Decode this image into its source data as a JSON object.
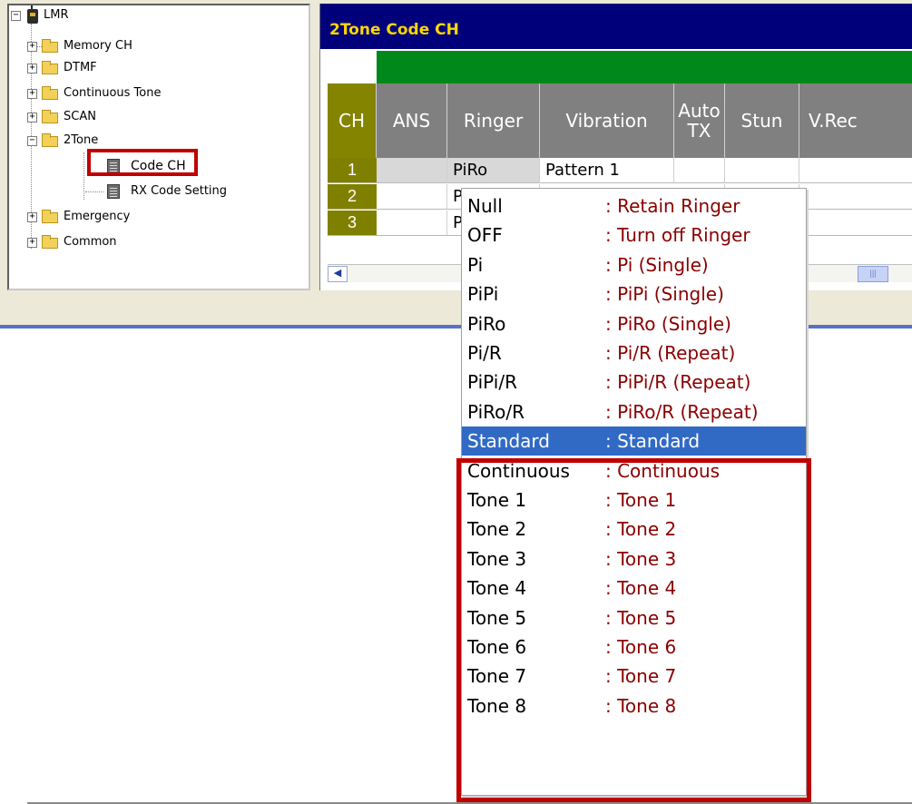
{
  "tree": {
    "root_label": "LMR",
    "expander_plus": "+",
    "expander_minus": "−",
    "items": [
      {
        "label": "Memory CH"
      },
      {
        "label": "DTMF"
      },
      {
        "label": "Continuous Tone"
      },
      {
        "label": "SCAN"
      },
      {
        "label": "2Tone"
      },
      {
        "label": "Code CH"
      },
      {
        "label": "RX Code Setting"
      },
      {
        "label": "Emergency"
      },
      {
        "label": "Common"
      }
    ]
  },
  "main": {
    "title": "2Tone Code CH",
    "columns": [
      "CH",
      "ANS",
      "Ringer",
      "Vibration",
      "Auto TX",
      "Stun",
      "V.Rec"
    ],
    "rows": [
      {
        "ch": "1",
        "ringer": "PiRo",
        "vibration": "Pattern 1"
      },
      {
        "ch": "2",
        "ringer": "P",
        "vibration": ""
      },
      {
        "ch": "3",
        "ringer": "P",
        "vibration": ""
      }
    ],
    "scroll_left_glyph": "◀",
    "scroll_thumb_glyph": "|||"
  },
  "dropdown": {
    "selected_index": 8,
    "options": [
      {
        "code": "Null",
        "desc": ": Retain Ringer"
      },
      {
        "code": "OFF",
        "desc": ": Turn off Ringer"
      },
      {
        "code": "Pi",
        "desc": ": Pi (Single)"
      },
      {
        "code": "PiPi",
        "desc": ": PiPi (Single)"
      },
      {
        "code": "PiRo",
        "desc": ": PiRo (Single)"
      },
      {
        "code": "Pi/R",
        "desc": ": Pi/R (Repeat)"
      },
      {
        "code": "PiPi/R",
        "desc": ": PiPi/R (Repeat)"
      },
      {
        "code": "PiRo/R",
        "desc": ": PiRo/R (Repeat)"
      },
      {
        "code": "Standard",
        "desc": ": Standard"
      },
      {
        "code": "Continuous",
        "desc": ": Continuous"
      },
      {
        "code": "Tone 1",
        "desc": ": Tone 1"
      },
      {
        "code": "Tone 2",
        "desc": ": Tone 2"
      },
      {
        "code": "Tone 3",
        "desc": ": Tone 3"
      },
      {
        "code": "Tone 4",
        "desc": ": Tone 4"
      },
      {
        "code": "Tone 5",
        "desc": ": Tone 5"
      },
      {
        "code": "Tone 6",
        "desc": ": Tone 6"
      },
      {
        "code": "Tone 7",
        "desc": ": Tone 7"
      },
      {
        "code": "Tone 8",
        "desc": ": Tone 8"
      }
    ]
  },
  "colors": {
    "title_bar": "#00007a",
    "title_text": "#ffd700",
    "header_green": "#00881a",
    "ch_column": "#808000",
    "highlight_red": "#c00000",
    "selection_blue": "#316ac5",
    "desc_text": "#8b0000"
  }
}
